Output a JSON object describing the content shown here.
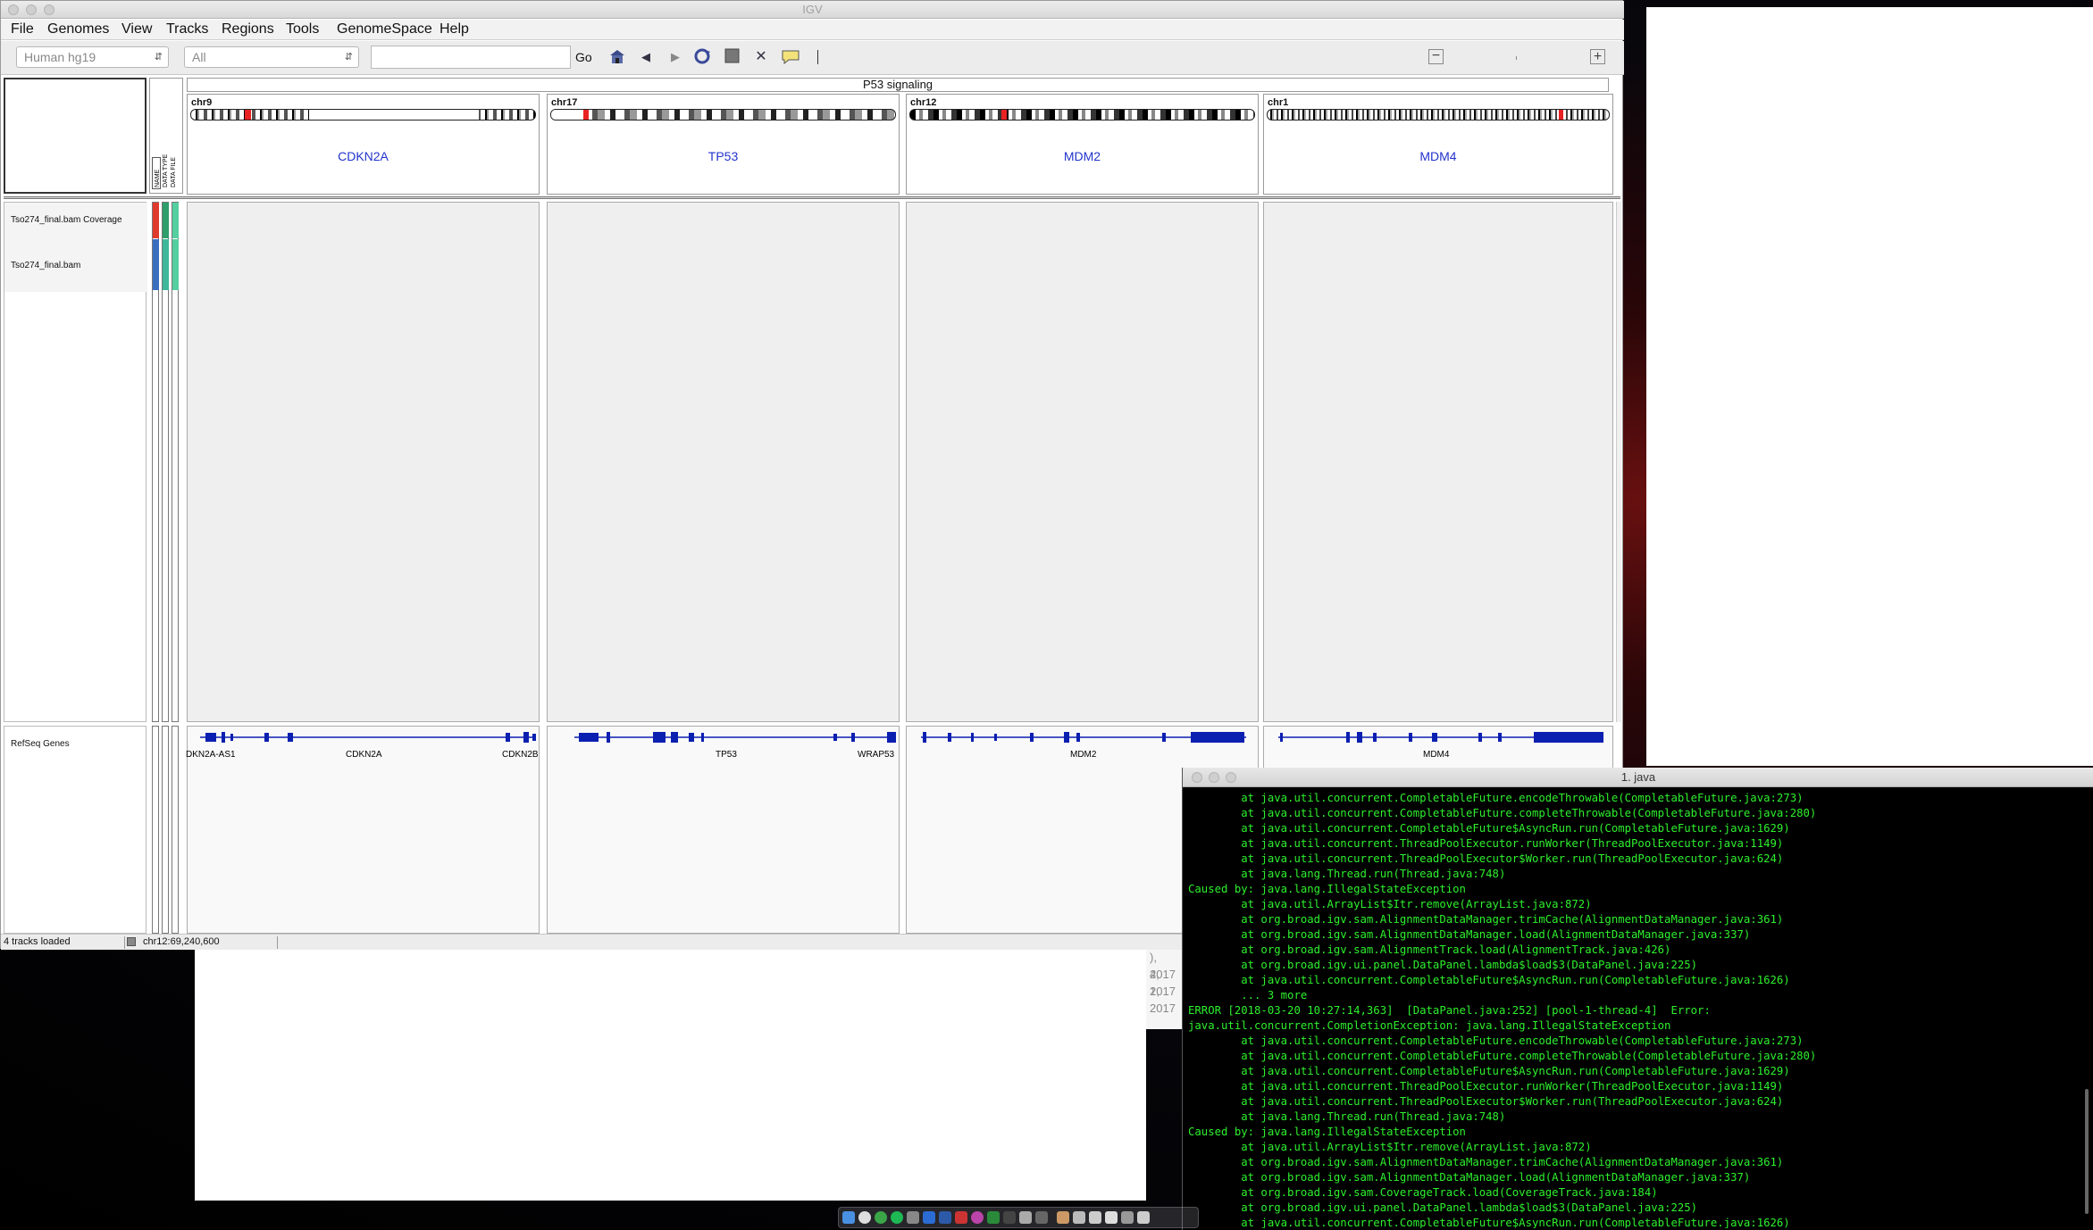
{
  "igv": {
    "window_title": "IGV",
    "menu": [
      "File",
      "Genomes",
      "View",
      "Tracks",
      "Regions",
      "Tools",
      "GenomeSpace",
      "Help"
    ],
    "genome_select": "Human hg19",
    "chromosome_select": "All",
    "locus_input": "",
    "go_label": "Go",
    "gene_list_title": "P53 signaling",
    "attribute_headers": [
      "NAME",
      "DATA TYPE",
      "DATA FILE"
    ],
    "regions": [
      {
        "chr": "chr9",
        "gene": "CDKN2A",
        "genes_track": [
          "DKN2A-AS1",
          "CDKN2A",
          "CDKN2B"
        ]
      },
      {
        "chr": "chr17",
        "gene": "TP53",
        "genes_track": [
          "TP53",
          "WRAP53"
        ]
      },
      {
        "chr": "chr12",
        "gene": "MDM2",
        "genes_track": [
          "MDM2"
        ]
      },
      {
        "chr": "chr1",
        "gene": "MDM4",
        "genes_track": [
          "MDM4"
        ]
      }
    ],
    "tracks": [
      "Tso274_final.bam Coverage",
      "Tso274_final.bam"
    ],
    "feature_track": "RefSeq Genes",
    "status_tracks": "4 tracks loaded",
    "status_locus": "chr12:69,240,600"
  },
  "background_doc": {
    "dates": [
      "), 2017",
      "4, 2017",
      "1, 2017"
    ]
  },
  "terminal": {
    "title": "1. java",
    "lines": [
      "        at java.util.concurrent.CompletableFuture.encodeThrowable(CompletableFuture.java:273)",
      "        at java.util.concurrent.CompletableFuture.completeThrowable(CompletableFuture.java:280)",
      "        at java.util.concurrent.CompletableFuture$AsyncRun.run(CompletableFuture.java:1629)",
      "        at java.util.concurrent.ThreadPoolExecutor.runWorker(ThreadPoolExecutor.java:1149)",
      "        at java.util.concurrent.ThreadPoolExecutor$Worker.run(ThreadPoolExecutor.java:624)",
      "        at java.lang.Thread.run(Thread.java:748)",
      "Caused by: java.lang.IllegalStateException",
      "        at java.util.ArrayList$Itr.remove(ArrayList.java:872)",
      "        at org.broad.igv.sam.AlignmentDataManager.trimCache(AlignmentDataManager.java:361)",
      "        at org.broad.igv.sam.AlignmentDataManager.load(AlignmentDataManager.java:337)",
      "        at org.broad.igv.sam.AlignmentTrack.load(AlignmentTrack.java:426)",
      "        at org.broad.igv.ui.panel.DataPanel.lambda$load$3(DataPanel.java:225)",
      "        at java.util.concurrent.CompletableFuture$AsyncRun.run(CompletableFuture.java:1626)",
      "        ... 3 more",
      "ERROR [2018-03-20 10:27:14,363]  [DataPanel.java:252] [pool-1-thread-4]  Error:",
      "java.util.concurrent.CompletionException: java.lang.IllegalStateException",
      "        at java.util.concurrent.CompletableFuture.encodeThrowable(CompletableFuture.java:273)",
      "        at java.util.concurrent.CompletableFuture.completeThrowable(CompletableFuture.java:280)",
      "        at java.util.concurrent.CompletableFuture$AsyncRun.run(CompletableFuture.java:1629)",
      "        at java.util.concurrent.ThreadPoolExecutor.runWorker(ThreadPoolExecutor.java:1149)",
      "        at java.util.concurrent.ThreadPoolExecutor$Worker.run(ThreadPoolExecutor.java:624)",
      "        at java.lang.Thread.run(Thread.java:748)",
      "Caused by: java.lang.IllegalStateException",
      "        at java.util.ArrayList$Itr.remove(ArrayList.java:872)",
      "        at org.broad.igv.sam.AlignmentDataManager.trimCache(AlignmentDataManager.java:361)",
      "        at org.broad.igv.sam.AlignmentDataManager.load(AlignmentDataManager.java:337)",
      "        at org.broad.igv.sam.CoverageTrack.load(CoverageTrack.java:184)",
      "        at org.broad.igv.ui.panel.DataPanel.lambda$load$3(DataPanel.java:225)",
      "        at java.util.concurrent.CompletableFuture$AsyncRun.run(CompletableFuture.java:1626)"
    ]
  },
  "colors": {
    "gene_label": "#2233cc",
    "gene_feature": "#0b1fb0",
    "terminal_text": "#2ef02e",
    "coverage_attr": "#e03a2e",
    "alignment_attr": "#3a6fc0",
    "attr_green": "#2e9e6a",
    "attr_teal": "#55cfa0"
  }
}
